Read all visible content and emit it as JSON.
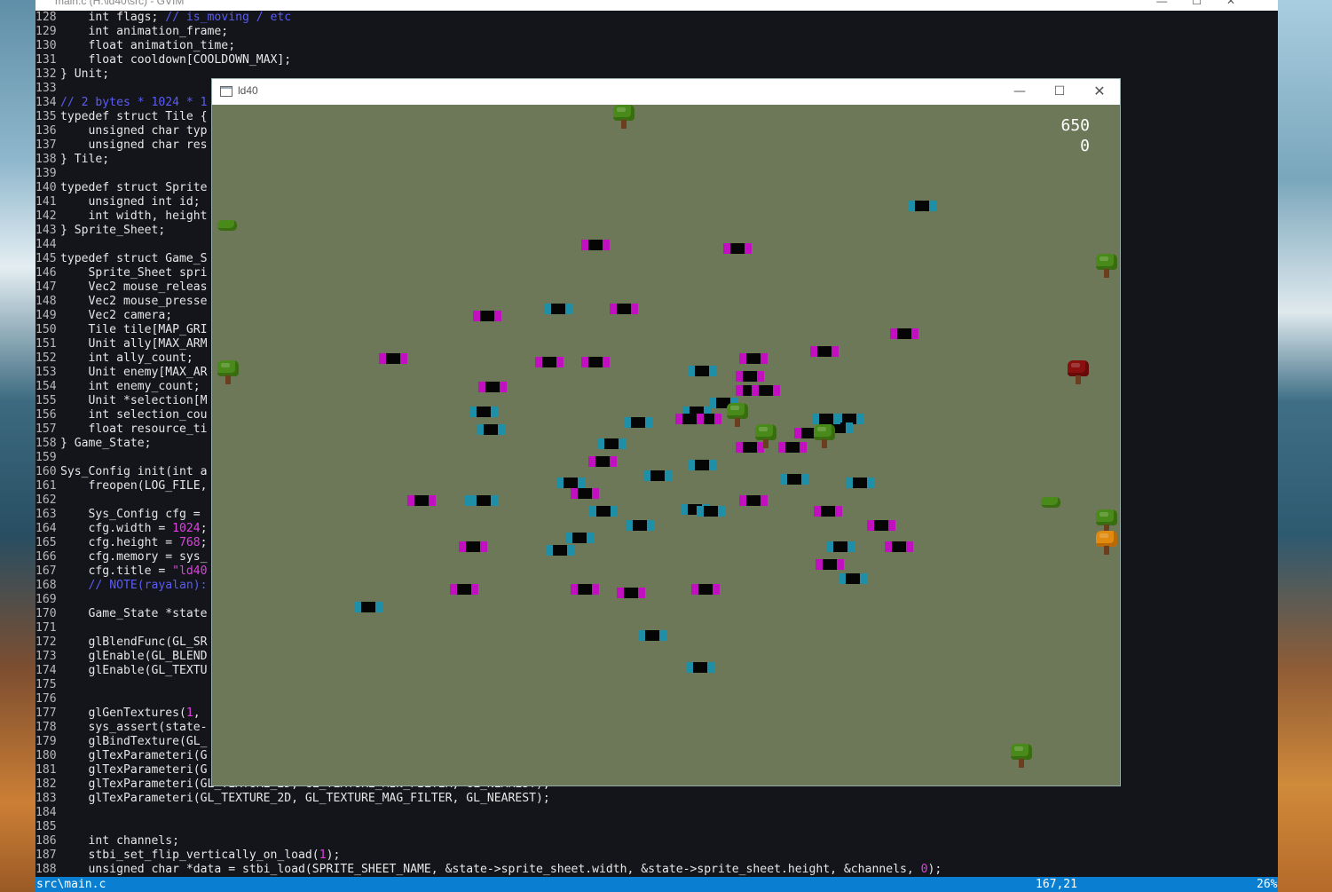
{
  "editor": {
    "title": "main.c (H:\\ld40\\src) - GVIM",
    "status": {
      "file": "src\\main.c",
      "position": "167,21",
      "percent": "26%"
    },
    "lines": [
      {
        "n": "128",
        "t": "    int flags; ",
        "c": "// is_moving / etc"
      },
      {
        "n": "129",
        "t": "    int animation_frame;"
      },
      {
        "n": "130",
        "t": "    float animation_time;"
      },
      {
        "n": "131",
        "t": "    float cooldown[COOLDOWN_MAX];"
      },
      {
        "n": "132",
        "t": "} Unit;"
      },
      {
        "n": "133",
        "t": ""
      },
      {
        "n": "134",
        "t": "",
        "c": "// 2 bytes * 1024 * 1"
      },
      {
        "n": "135",
        "t": "typedef struct Tile {"
      },
      {
        "n": "136",
        "t": "    unsigned char typ"
      },
      {
        "n": "137",
        "t": "    unsigned char res"
      },
      {
        "n": "138",
        "t": "} Tile;"
      },
      {
        "n": "139",
        "t": ""
      },
      {
        "n": "140",
        "t": "typedef struct Sprite"
      },
      {
        "n": "141",
        "t": "    unsigned int id;"
      },
      {
        "n": "142",
        "t": "    int width, height"
      },
      {
        "n": "143",
        "t": "} Sprite_Sheet;"
      },
      {
        "n": "144",
        "t": ""
      },
      {
        "n": "145",
        "t": "typedef struct Game_S"
      },
      {
        "n": "146",
        "t": "    Sprite_Sheet spri"
      },
      {
        "n": "147",
        "t": "    Vec2 mouse_releas"
      },
      {
        "n": "148",
        "t": "    Vec2 mouse_presse"
      },
      {
        "n": "149",
        "t": "    Vec2 camera;"
      },
      {
        "n": "150",
        "t": "    Tile tile[MAP_GRI"
      },
      {
        "n": "151",
        "t": "    Unit ally[MAX_ARM"
      },
      {
        "n": "152",
        "t": "    int ally_count;"
      },
      {
        "n": "153",
        "t": "    Unit enemy[MAX_AR"
      },
      {
        "n": "154",
        "t": "    int enemy_count;"
      },
      {
        "n": "155",
        "t": "    Unit *selection[M"
      },
      {
        "n": "156",
        "t": "    int selection_cou"
      },
      {
        "n": "157",
        "t": "    float resource_ti"
      },
      {
        "n": "158",
        "t": "} Game_State;"
      },
      {
        "n": "159",
        "t": ""
      },
      {
        "n": "160",
        "t": "Sys_Config init(int a"
      },
      {
        "n": "161",
        "t": "    freopen(LOG_FILE,"
      },
      {
        "n": "162",
        "t": ""
      },
      {
        "n": "163",
        "t": "    Sys_Config cfg = "
      },
      {
        "n": "164",
        "t": "    cfg.width = ",
        "num": "1024",
        "t2": ";"
      },
      {
        "n": "165",
        "t": "    cfg.height = ",
        "num": "768",
        "t2": ";"
      },
      {
        "n": "166",
        "t": "    cfg.memory = sys_"
      },
      {
        "n": "167",
        "t": "    cfg.title = ",
        "str": "\"ld40"
      },
      {
        "n": "168",
        "t": "    ",
        "c": "// NOTE(rayalan):"
      },
      {
        "n": "169",
        "t": ""
      },
      {
        "n": "170",
        "t": "    Game_State *state"
      },
      {
        "n": "171",
        "t": ""
      },
      {
        "n": "172",
        "t": "    glBlendFunc(GL_SR"
      },
      {
        "n": "173",
        "t": "    glEnable(GL_BLEND"
      },
      {
        "n": "174",
        "t": "    glEnable(GL_TEXTU"
      },
      {
        "n": "175",
        "t": ""
      },
      {
        "n": "176",
        "t": ""
      },
      {
        "n": "177",
        "t": "    glGenTextures(",
        "num": "1",
        "t2": ","
      },
      {
        "n": "178",
        "t": "    sys_assert(state-"
      },
      {
        "n": "179",
        "t": "    glBindTexture(GL_"
      },
      {
        "n": "180",
        "t": "    glTexParameteri(G"
      },
      {
        "n": "181",
        "t": "    glTexParameteri(G"
      },
      {
        "n": "182",
        "t": "    glTexParameteri(GL_TEXTURE_2D, GL_TEXTURE_MIN_FILTER, GL_NEAREST);"
      },
      {
        "n": "183",
        "t": "    glTexParameteri(GL_TEXTURE_2D, GL_TEXTURE_MAG_FILTER, GL_NEAREST);"
      },
      {
        "n": "184",
        "t": ""
      },
      {
        "n": "185",
        "t": ""
      },
      {
        "n": "186",
        "t": "    int channels;"
      },
      {
        "n": "187",
        "t": "    stbi_set_flip_vertically_on_load(",
        "num": "1",
        "t2": ");"
      },
      {
        "n": "188",
        "t": "    unsigned char *data = stbi_load(SPRITE_SHEET_NAME, &state->sprite_sheet.width, &state->sprite_sheet.height, &channels, ",
        "num": "0",
        "t2": ");"
      }
    ]
  },
  "game": {
    "title": "ld40",
    "controls": {
      "minimize": "—",
      "maximize": "☐",
      "close": "✕"
    },
    "hud": {
      "line1": "650",
      "line2": "0"
    },
    "map_objects": {
      "allies": 30,
      "enemies": 32,
      "trees": [
        {
          "color": "green"
        },
        {
          "color": "green"
        },
        {
          "color": "green"
        },
        {
          "color": "red"
        },
        {
          "color": "green"
        },
        {
          "color": "green"
        },
        {
          "color": "green"
        },
        {
          "color": "green"
        },
        {
          "color": "orange"
        },
        {
          "color": "green"
        }
      ]
    }
  },
  "colors": {
    "grass": "#6d7858",
    "ally_accent": "#1f8fa8",
    "enemy_accent": "#c010c0",
    "status_bar": "#0a7fd1"
  }
}
